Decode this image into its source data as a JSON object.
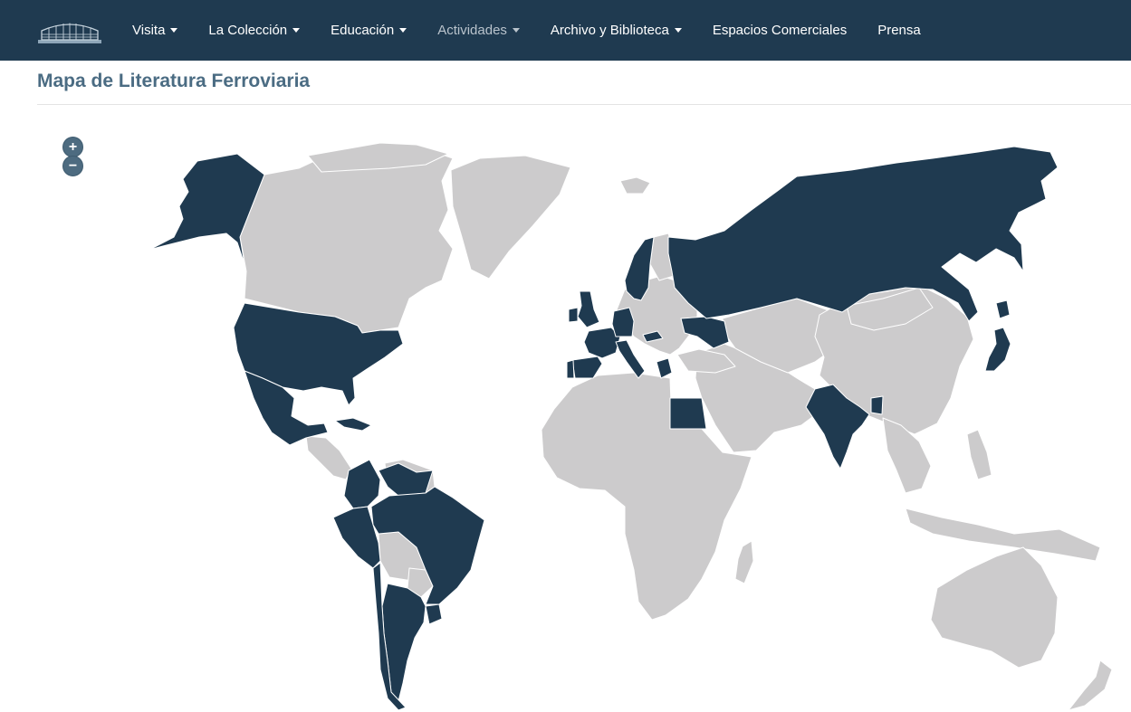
{
  "header": {
    "logo_icon": "museum-building-logo",
    "menu": [
      {
        "label": "Visita",
        "has_dropdown": true,
        "active": false
      },
      {
        "label": "La Colección",
        "has_dropdown": true,
        "active": false
      },
      {
        "label": "Educación",
        "has_dropdown": true,
        "active": false
      },
      {
        "label": "Actividades",
        "has_dropdown": true,
        "active": true
      },
      {
        "label": "Archivo y Biblioteca",
        "has_dropdown": true,
        "active": false
      },
      {
        "label": "Espacios Comerciales",
        "has_dropdown": false,
        "active": false
      },
      {
        "label": "Prensa",
        "has_dropdown": false,
        "active": false
      }
    ]
  },
  "page": {
    "title": "Mapa de Literatura Ferroviaria"
  },
  "map": {
    "zoom_in_label": "+",
    "zoom_out_label": "−",
    "colors": {
      "highlighted": "#1f3a50",
      "other": "#cccbcc",
      "border": "#ffffff",
      "nav_background": "#1f3a50"
    },
    "highlighted_countries": [
      "Alaska (USA)",
      "United States",
      "Mexico",
      "Cuba",
      "Colombia",
      "Venezuela",
      "Peru",
      "Brazil",
      "Argentina",
      "Uruguay",
      "Chile",
      "United Kingdom",
      "Ireland",
      "France",
      "Spain",
      "Portugal",
      "Germany",
      "Italy",
      "Sweden",
      "Norway",
      "Hungary",
      "Greece",
      "Ukraine",
      "Russia",
      "Egypt",
      "India",
      "Bangladesh",
      "Japan"
    ]
  }
}
